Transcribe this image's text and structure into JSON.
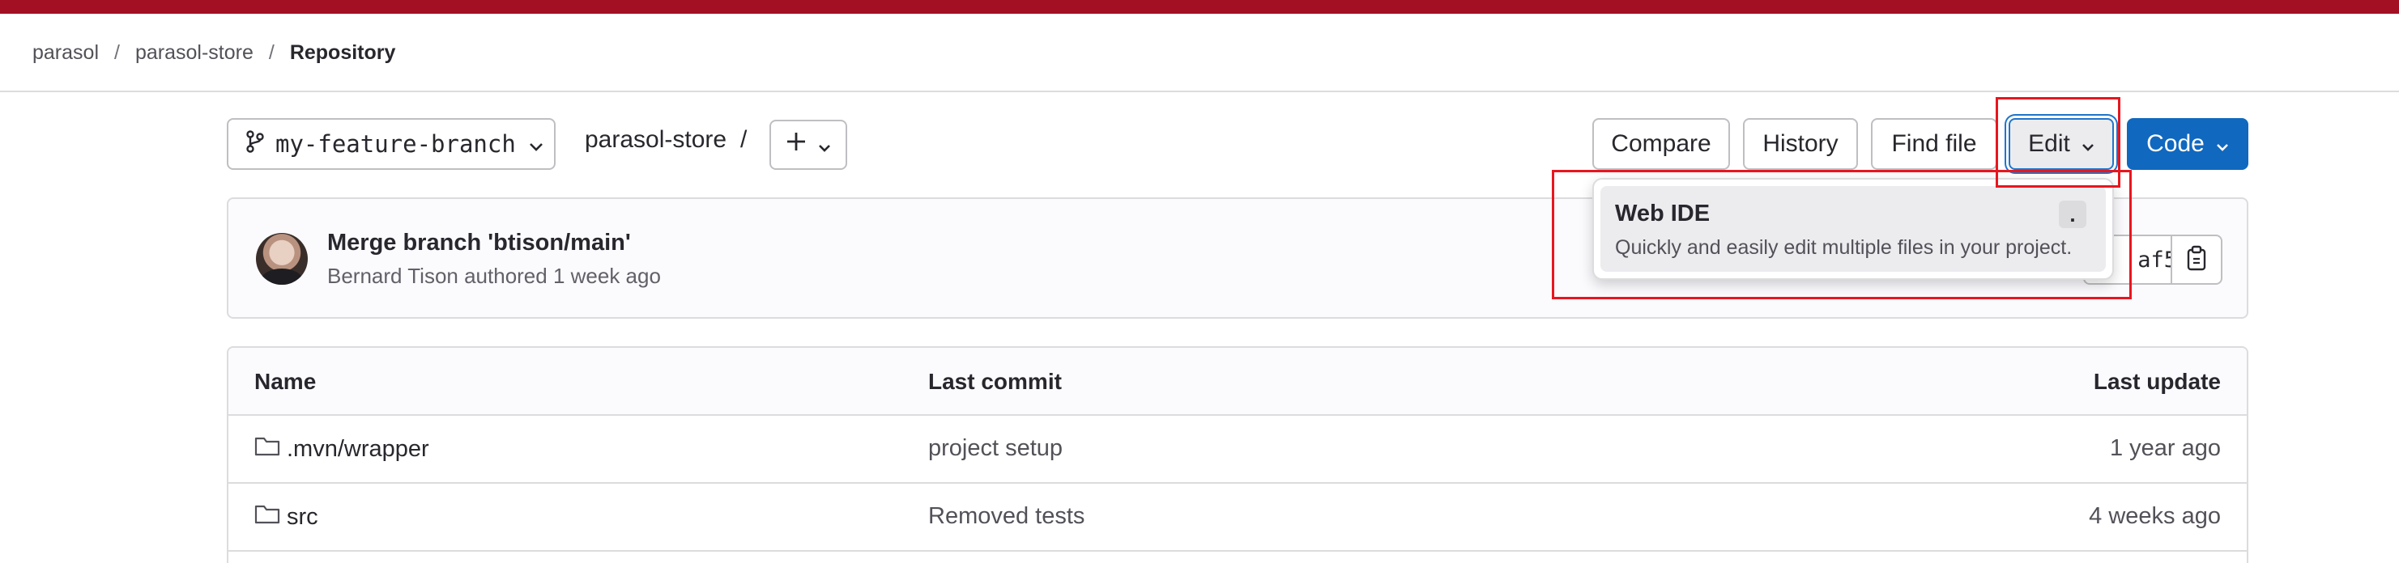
{
  "colors": {
    "topbar": "#a31024",
    "primary": "#1068bf",
    "annotation": "#e8161f"
  },
  "breadcrumb": {
    "items": [
      "parasol",
      "parasol-store"
    ],
    "separator": "/",
    "current": "Repository"
  },
  "toolbar": {
    "branch": "my-feature-branch",
    "path": "parasol-store",
    "path_separator": "/",
    "add_icon": "plus-icon",
    "compare_label": "Compare",
    "history_label": "History",
    "find_file_label": "Find file",
    "edit_label": "Edit",
    "code_label": "Code"
  },
  "commit": {
    "title": "Merge branch 'btison/main'",
    "meta": "Bernard Tison authored 1 week ago",
    "sha": "af5"
  },
  "edit_dropdown": {
    "items": [
      {
        "title": "Web IDE",
        "description": "Quickly and easily edit multiple files in your project.",
        "shortcut": "."
      }
    ]
  },
  "files": {
    "columns": [
      "Name",
      "Last commit",
      "Last update"
    ],
    "rows": [
      {
        "name": ".mvn/wrapper",
        "commit": "project setup",
        "updated": "1 year ago",
        "icon": "folder-icon"
      },
      {
        "name": "src",
        "commit": "Removed tests",
        "updated": "4 weeks ago",
        "icon": "folder-icon"
      }
    ]
  }
}
